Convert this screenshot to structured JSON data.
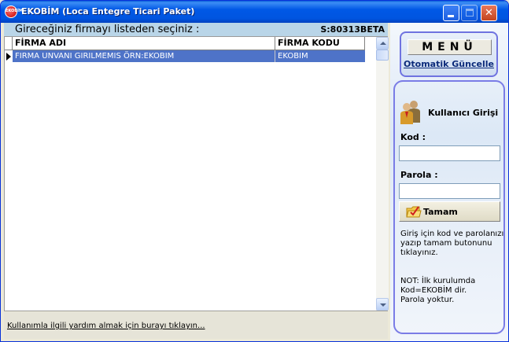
{
  "window": {
    "title": "EKOBİM (Loca Entegre Ticari Paket)",
    "icon_text": "EKOBİM",
    "icon": "app-logo-icon",
    "controls": [
      "minimize-icon",
      "maximize-icon",
      "close-icon"
    ]
  },
  "header": {
    "title": "Gireceğiniz firmayı listeden seçiniz :",
    "version": "S:80313BETA"
  },
  "grid": {
    "columns": [
      "FİRMA ADI",
      "FİRMA KODU"
    ],
    "rows": [
      {
        "name": "FIRMA UNVANI GIRILMEMIS ÖRN:EKOBIM",
        "code": "EKOBIM",
        "selected": true
      }
    ],
    "selection_color": "#4E73C8"
  },
  "help": {
    "link_text": "Kullanımla ilgili yardım almak için burayı tıklayın..."
  },
  "menu": {
    "button_label": "MENÜ",
    "update_link": "Otomatik Güncelle"
  },
  "login": {
    "title": "Kullanıcı Girişi",
    "icon": "users-icon",
    "kod_label": "Kod   :",
    "kod_value": "",
    "parola_label": "Parola :",
    "parola_value": "",
    "ok_label": "Tamam",
    "ok_icon": "check-folder-icon",
    "info": "Giriş için kod ve parolanızı\nyazıp tamam butonunu\ntıklayınız.",
    "note": "NOT: İlk kurulumda\nKod=EKOBİM dir.\nParola yoktur."
  },
  "colors": {
    "titlebar": "#0058E6",
    "header_bar": "#B9D5E8",
    "panel_border": "#7A7CE6"
  }
}
